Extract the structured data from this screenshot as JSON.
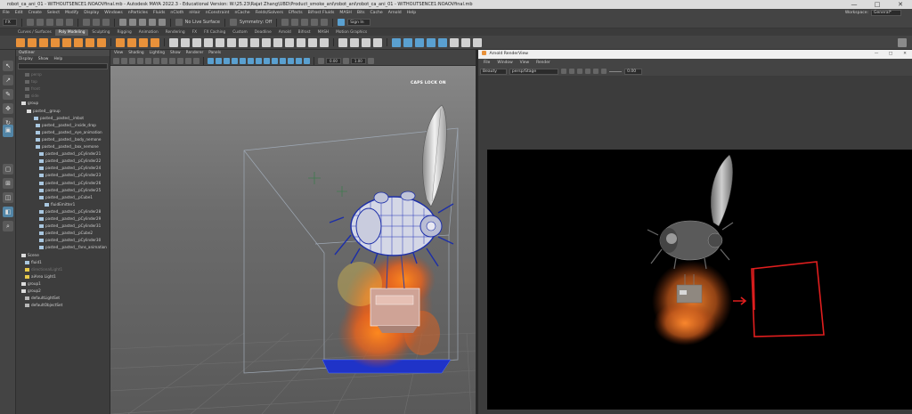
{
  "window": {
    "title": "robot_ca_ani_01 - WITHOUTSENCE1:NOAOVfinal.mb - Autodesk MAYA 2022.3 - Educational Version: W:\\25.23\\Rajat Zhang\\UBD\\Product_smoke_ani\\robot_ani\\robot_ca_ani_01 - WITHOUTSENCE1:NOAOVfinal.mb",
    "controls": [
      "—",
      "□",
      "✕"
    ]
  },
  "menubar": {
    "items": [
      "File",
      "Edit",
      "Create",
      "Select",
      "Modify",
      "Display",
      "Windows",
      "nParticles",
      "Fluids",
      "nCloth",
      "nHair",
      "nConstraint",
      "nCache",
      "Fields/Solvers",
      "Effects",
      "Bifrost Fluids",
      "MASH",
      "Bits",
      "Cache",
      "Arnold",
      "Help"
    ],
    "workspace_label": "Workspace:",
    "workspace_value": "General*"
  },
  "statusline": {
    "mode": "FX",
    "surface": "No Live Surface",
    "symmetry": "Symmetry: Off",
    "signin": "Sign In"
  },
  "shelf": {
    "tabs": [
      "Curves / Surfaces",
      "Poly Modeling",
      "Sculpting",
      "Rigging",
      "Animation",
      "Rendering",
      "FX",
      "FX Caching",
      "Custom",
      "Deadline",
      "Arnold",
      "Bifrost",
      "MASH",
      "Motion Graphics"
    ],
    "active_tab": "Poly Modeling"
  },
  "outliner": {
    "title": "Outliner",
    "menu": [
      "Display",
      "Show",
      "Help"
    ],
    "rows": [
      {
        "label": "persp",
        "dim": true
      },
      {
        "label": "top",
        "dim": true
      },
      {
        "label": "front",
        "dim": true
      },
      {
        "label": "side",
        "dim": true
      },
      {
        "label": "group",
        "dim": false,
        "type": "grp"
      },
      {
        "label": "pasted__group",
        "dim": false,
        "type": "grp"
      },
      {
        "label": "pasted__pasted__imbot",
        "dim": false,
        "type": "mesh"
      },
      {
        "label": "pasted__pasted__inside_drop",
        "dim": false,
        "type": "mesh"
      },
      {
        "label": "pasted__pasted__eye_animation",
        "dim": false,
        "type": "mesh"
      },
      {
        "label": "pasted__pasted__body_nemone",
        "dim": false,
        "type": "mesh"
      },
      {
        "label": "pasted__pasted__box_nemone",
        "dim": false,
        "type": "mesh"
      },
      {
        "label": "pasted__pasted__pCylinder21",
        "dim": false,
        "type": "mesh"
      },
      {
        "label": "pasted__pasted__pCylinder22",
        "dim": false,
        "type": "mesh"
      },
      {
        "label": "pasted__pasted__pCylinder24",
        "dim": false,
        "type": "mesh"
      },
      {
        "label": "pasted__pasted__pCylinder23",
        "dim": false,
        "type": "mesh"
      },
      {
        "label": "pasted__pasted__pCylinder26",
        "dim": false,
        "type": "mesh"
      },
      {
        "label": "pasted__pasted__pCylinder25",
        "dim": false,
        "type": "mesh"
      },
      {
        "label": "pasted__pasted__pCube1",
        "dim": false,
        "type": "mesh"
      },
      {
        "label": "fluidEmitter1",
        "dim": false,
        "type": "mesh"
      },
      {
        "label": "pasted__pasted__pCylinder28",
        "dim": false,
        "type": "mesh"
      },
      {
        "label": "pasted__pasted__pCylinder29",
        "dim": false,
        "type": "mesh"
      },
      {
        "label": "pasted__pasted__pCylinder31",
        "dim": false,
        "type": "mesh"
      },
      {
        "label": "pasted__pasted__pCube2",
        "dim": false,
        "type": "mesh"
      },
      {
        "label": "pasted__pasted__pCylinder30",
        "dim": false,
        "type": "mesh"
      },
      {
        "label": "pasted__pasted__fans_animation",
        "dim": false,
        "type": "mesh"
      },
      {
        "label": "Scene",
        "dim": false,
        "type": "grp"
      },
      {
        "label": "fluid1",
        "dim": false,
        "type": "mesh"
      },
      {
        "label": "directionalLight1",
        "dim": true,
        "type": "light"
      },
      {
        "label": "aiArea Light1",
        "dim": false,
        "type": "light"
      },
      {
        "label": "group1",
        "dim": false,
        "type": "grp"
      },
      {
        "label": "group2",
        "dim": false,
        "type": "grp"
      },
      {
        "label": "defaultLightSet",
        "dim": false,
        "type": "set"
      },
      {
        "label": "defaultObjectSet",
        "dim": false,
        "type": "set"
      }
    ]
  },
  "viewport": {
    "menu": [
      "View",
      "Shading",
      "Lighting",
      "Show",
      "Renderer",
      "Panels"
    ],
    "field_a": "0.00",
    "field_b": "1.00",
    "overlay": "CAPS LOCK ON"
  },
  "render_view": {
    "title": "Arnold RenderView",
    "menu": [
      "File",
      "Window",
      "View",
      "Render"
    ],
    "camera": "Beauty",
    "layer": "persp/Stage",
    "exposure": "0.00"
  },
  "colors": {
    "maya_bg": "#444444",
    "accent_orange": "#e8913a",
    "accent_blue": "#5285a6",
    "annotation_red": "#e01e1e"
  }
}
